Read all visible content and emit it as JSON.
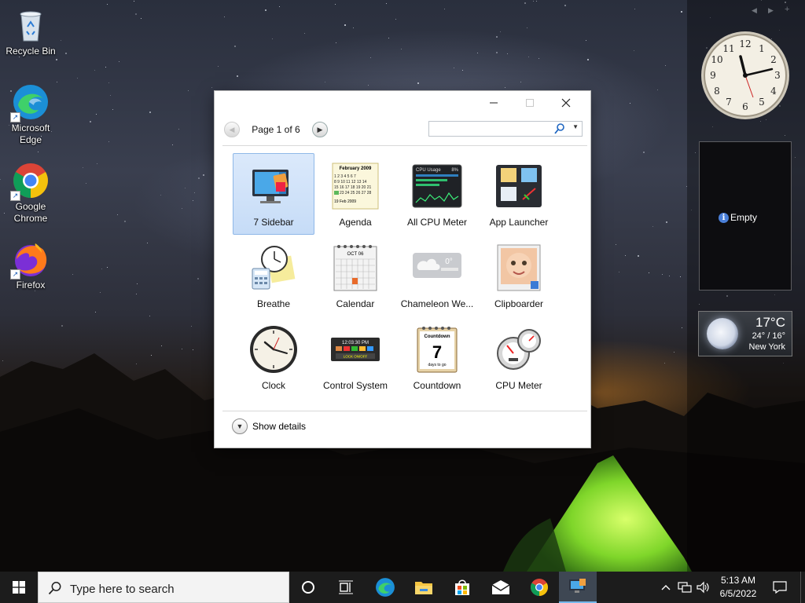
{
  "desktop": {
    "icons": [
      {
        "label": "Recycle Bin",
        "icon": "recycle-bin-icon"
      },
      {
        "label": "Microsoft Edge",
        "icon": "edge-icon"
      },
      {
        "label": "Google Chrome",
        "icon": "chrome-icon"
      },
      {
        "label": "Firefox",
        "icon": "firefox-icon"
      }
    ]
  },
  "gadget_window": {
    "page_label": "Page 1 of 6",
    "search_placeholder": "",
    "tiles": [
      {
        "label": "7 Sidebar",
        "icon": "sidebar-monitor-icon",
        "selected": true
      },
      {
        "label": "Agenda",
        "icon": "agenda-calendar-icon",
        "selected": false
      },
      {
        "label": "All CPU Meter",
        "icon": "cpu-usage-graph-icon",
        "selected": false
      },
      {
        "label": "App Launcher",
        "icon": "app-launcher-icon",
        "selected": false
      },
      {
        "label": "Breathe",
        "icon": "breathe-clock-icon",
        "selected": false
      },
      {
        "label": "Calendar",
        "icon": "calendar-icon",
        "selected": false
      },
      {
        "label": "Chameleon We...",
        "icon": "weather-cloud-icon",
        "selected": false
      },
      {
        "label": "Clipboarder",
        "icon": "clipboarder-photo-icon",
        "selected": false
      },
      {
        "label": "Clock",
        "icon": "clock-icon",
        "selected": false
      },
      {
        "label": "Control System",
        "icon": "control-system-icon",
        "selected": false
      },
      {
        "label": "Countdown",
        "icon": "countdown-calendar-icon",
        "selected": false
      },
      {
        "label": "CPU Meter",
        "icon": "cpu-meter-gauge-icon",
        "selected": false
      }
    ],
    "mini_text": {
      "agenda_header": "February 2009",
      "agenda_date": "19 Feb 2009",
      "cpu_title": "CPU Usage",
      "cpu_pct": "8%",
      "calendar_month": "OCT 06",
      "chameleon_temp": "0°",
      "control_time": "12:03:30 PM",
      "control_lock": "LOCK ON/OFF",
      "countdown_title": "Countdown",
      "countdown_num": "7",
      "countdown_sub": "days to go"
    },
    "show_details_label": "Show details"
  },
  "sidebar": {
    "empty_label": "Empty",
    "weather": {
      "temp": "17°C",
      "range": "24° / 16°",
      "city": "New York"
    }
  },
  "taskbar": {
    "search_placeholder": "Type here to search",
    "time": "5:13 AM",
    "date": "6/5/2022",
    "pinned": [
      "cortana-circle-icon",
      "task-view-icon",
      "edge-icon",
      "file-explorer-icon",
      "store-icon",
      "mail-icon",
      "chrome-icon",
      "gadgets-icon"
    ]
  },
  "colors": {
    "selection": "#c6dcf7",
    "taskbar": "#1c1c1c",
    "accent": "#76b9ed"
  }
}
